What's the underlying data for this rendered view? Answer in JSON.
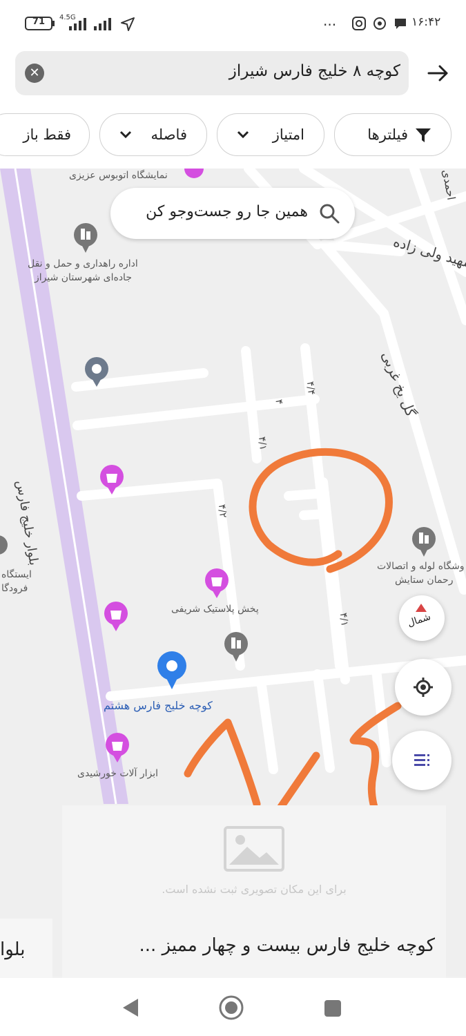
{
  "status_bar": {
    "battery": "71",
    "network": "4.5G",
    "time": "۱۶:۴۲",
    "dots": "..."
  },
  "search": {
    "query": "کوچه ۸ خلیج فارس شیراز",
    "clear_icon": "close-icon",
    "back_icon": "arrow-forward-icon"
  },
  "filters": {
    "filters_label": "فیلترها",
    "rating_label": "امتیاز",
    "distance_label": "فاصله",
    "open_only_label": "فقط باز"
  },
  "map": {
    "search_here": "همین جا رو جست‌وجو کن",
    "compass_label": "شمال",
    "colors": {
      "boulevard": "#d9c8ef",
      "pin_blue": "#2f7fe8",
      "pin_pink": "#d44fe0",
      "pin_gray": "#777777",
      "annotation": "#f07a3a"
    },
    "poi_labels": {
      "bus_showroom": "نمایشگاه اتوبوس عزیزی",
      "road_office_1": "اداره راهداری و حمل و نقل",
      "road_office_2": "جاده‌ای شهرستان شیراز",
      "plastic": "پخش پلاستیک شریفی",
      "tools": "ابزار آلات خورشیدی",
      "pipe_1": "وشگاه لوله و اتصالات",
      "pipe_2": "رحمان ستایش",
      "station_1": "ایستگاه",
      "station_2": "فرودگا",
      "selected_place": "کوچه خلیج فارس هشتم"
    },
    "street_labels": {
      "boulevard": "بلوار خلیج فارس",
      "vali_zadeh": "شهید ولی زاده",
      "gol_yakh": "گل یخ غربی",
      "ahmadi": "احمدی",
      "s4": "۴",
      "s4_4": "۴/۴",
      "s4_1a": "۴/۱",
      "s4_1b": "۴/۱",
      "s4_2": "۴/۲"
    },
    "handwritten": "۸/۴"
  },
  "result_card": {
    "no_image_text": "برای این مکان تصویری ثبت نشده است.",
    "title": "کوچه خلیج فارس بیست و چهار ممیز ...",
    "next_title": "بلوا"
  }
}
